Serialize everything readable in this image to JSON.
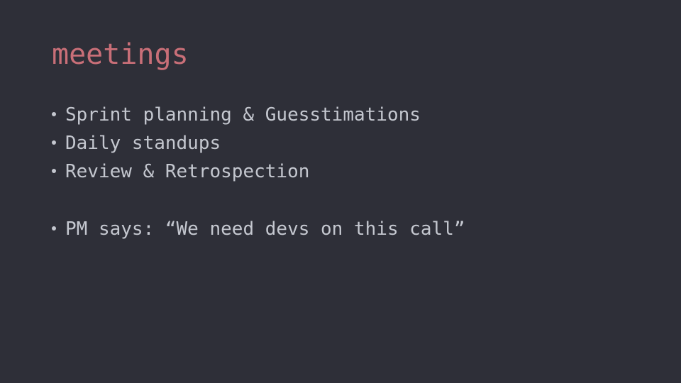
{
  "slide": {
    "title": "meetings",
    "bullets": [
      "Sprint planning & Guesstimations",
      "Daily standups",
      "Review & Retrospection",
      "PM says: “We need devs on this call”"
    ]
  },
  "colors": {
    "background": "#2e2f38",
    "title": "#c96f78",
    "text": "#c4c7cf"
  }
}
